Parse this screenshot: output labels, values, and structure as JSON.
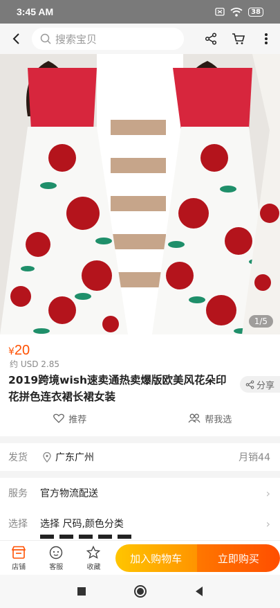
{
  "status": {
    "time": "3:45 AM",
    "battery": "38"
  },
  "search": {
    "placeholder": "搜索宝贝"
  },
  "gallery": {
    "pager": "1/5"
  },
  "product": {
    "currency": "¥",
    "price": "20",
    "usd_price": "约 USD 2.85",
    "title": "2019跨境wish速卖通热卖爆版欧美风花朵印花拼色连衣裙长裙女装",
    "share_label": "分享",
    "recommend_label": "推荐",
    "help_choose_label": "帮我选"
  },
  "shipping": {
    "label": "发货",
    "location": "广东广州",
    "monthly_sales": "月销44"
  },
  "services": {
    "service_label": "服务",
    "service_value": "官方物流配送",
    "select_label": "选择",
    "select_value": "选择 尺码,颜色分类"
  },
  "bottom": {
    "store": "店铺",
    "support": "客服",
    "favorite": "收藏",
    "add_cart": "加入购物车",
    "buy_now": "立即购买"
  },
  "colors": {
    "accent": "#ff5000",
    "cart_gradient": "#ffb000",
    "buy_gradient": "#ff5a00"
  }
}
